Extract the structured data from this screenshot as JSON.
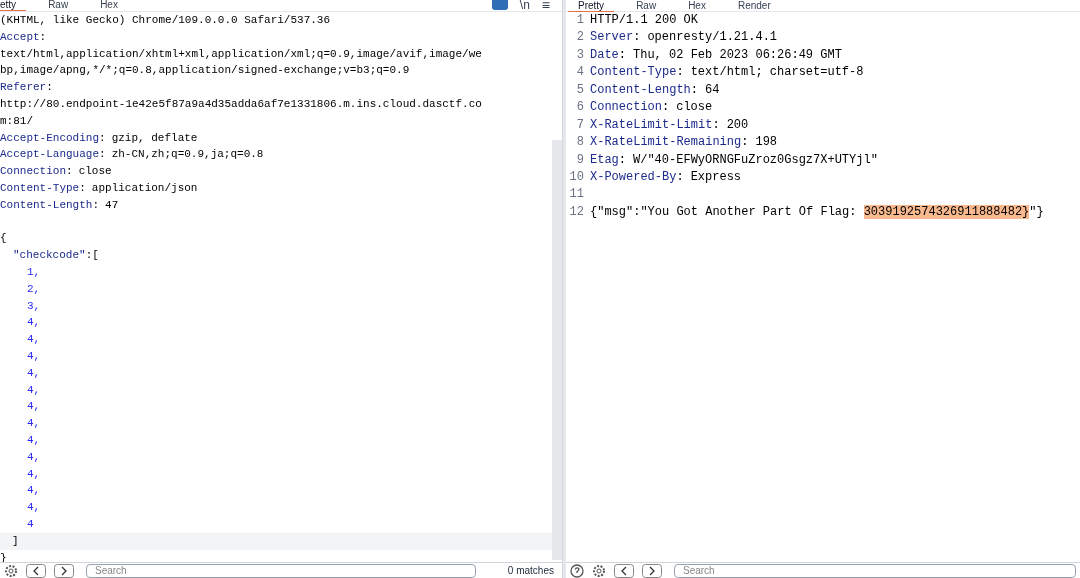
{
  "request_pane": {
    "tabs": [
      {
        "label": "etty",
        "selected": true
      },
      {
        "label": "Raw",
        "selected": false
      },
      {
        "label": "Hex",
        "selected": false
      }
    ],
    "toolbar": {
      "wrap_on": true,
      "newline_label": "\\n",
      "menu_label": "≡"
    },
    "lines": [
      {
        "kind": "text",
        "text": "(KHTML, like Gecko) Chrome/109.0.0.0 Safari/537.36",
        "current": false
      },
      {
        "kind": "header",
        "name": "Accept",
        "separator": ":",
        "current": false
      },
      {
        "kind": "text",
        "text": "text/html,application/xhtml+xml,application/xml;q=0.9,image/avif,image/we",
        "current": false
      },
      {
        "kind": "text",
        "text": "bp,image/apng,*/*;q=0.8,application/signed-exchange;v=b3;q=0.9",
        "current": false
      },
      {
        "kind": "header",
        "name": "Referer",
        "separator": ":",
        "current": false
      },
      {
        "kind": "text",
        "text": "http://80.endpoint-1e42e5f87a9a4d35adda6af7e1331806.m.ins.cloud.dasctf.co",
        "current": false
      },
      {
        "kind": "text",
        "text": "m:81/",
        "current": false
      },
      {
        "kind": "header",
        "name": "Accept-Encoding",
        "separator": ":",
        "value": "gzip, deflate",
        "current": false
      },
      {
        "kind": "header",
        "name": "Accept-Language",
        "separator": ":",
        "value": "zh-CN,zh;q=0.9,ja;q=0.8",
        "current": false
      },
      {
        "kind": "header",
        "name": "Connection",
        "separator": ":",
        "value": "close",
        "current": false
      },
      {
        "kind": "header",
        "name": "Content-Type",
        "separator": ":",
        "value": "application/json",
        "current": false
      },
      {
        "kind": "header",
        "name": "Content-Length",
        "separator": ":",
        "value": "47",
        "current": false
      },
      {
        "kind": "blank",
        "current": false
      },
      {
        "kind": "brace",
        "text": "{",
        "current": false
      },
      {
        "kind": "key",
        "key": "\"checkcode\"",
        "rest": ":[",
        "current": false
      },
      {
        "kind": "number",
        "text": "1,",
        "current": false
      },
      {
        "kind": "number",
        "text": "2,",
        "current": false
      },
      {
        "kind": "number",
        "text": "3,",
        "current": false
      },
      {
        "kind": "number",
        "text": "4,",
        "current": false
      },
      {
        "kind": "number",
        "text": "4,",
        "current": false
      },
      {
        "kind": "number",
        "text": "4,",
        "current": false
      },
      {
        "kind": "number",
        "text": "4,",
        "current": false
      },
      {
        "kind": "number",
        "text": "4,",
        "current": false
      },
      {
        "kind": "number",
        "text": "4,",
        "current": false
      },
      {
        "kind": "number",
        "text": "4,",
        "current": false
      },
      {
        "kind": "number",
        "text": "4,",
        "current": false
      },
      {
        "kind": "number",
        "text": "4,",
        "current": false
      },
      {
        "kind": "number",
        "text": "4,",
        "current": false
      },
      {
        "kind": "number",
        "text": "4,",
        "current": false
      },
      {
        "kind": "number",
        "text": "4,",
        "current": false
      },
      {
        "kind": "number",
        "text": "4",
        "current": false
      },
      {
        "kind": "bracket",
        "text": "]",
        "current": true
      },
      {
        "kind": "brace",
        "text": "}",
        "current": false
      }
    ],
    "search": {
      "placeholder": "Search",
      "matches": "0 matches"
    }
  },
  "response_pane": {
    "tabs": [
      {
        "label": "Pretty",
        "selected": true
      },
      {
        "label": "Raw",
        "selected": false
      },
      {
        "label": "Hex",
        "selected": false
      },
      {
        "label": "Render",
        "selected": false
      }
    ],
    "lines": [
      {
        "number": "1",
        "kind": "status",
        "text": "HTTP/1.1 200 OK"
      },
      {
        "number": "2",
        "kind": "header",
        "name": "Server",
        "separator": ":",
        "value": "openresty/1.21.4.1"
      },
      {
        "number": "3",
        "kind": "header",
        "name": "Date",
        "separator": ":",
        "value": "Thu, 02 Feb 2023 06:26:49 GMT"
      },
      {
        "number": "4",
        "kind": "header",
        "name": "Content-Type",
        "separator": ":",
        "value": "text/html; charset=utf-8"
      },
      {
        "number": "5",
        "kind": "header",
        "name": "Content-Length",
        "separator": ":",
        "value": "64"
      },
      {
        "number": "6",
        "kind": "header",
        "name": "Connection",
        "separator": ":",
        "value": "close"
      },
      {
        "number": "7",
        "kind": "header",
        "name": "X-RateLimit-Limit",
        "separator": ":",
        "value": "200"
      },
      {
        "number": "8",
        "kind": "header",
        "name": "X-RateLimit-Remaining",
        "separator": ":",
        "value": "198"
      },
      {
        "number": "9",
        "kind": "header",
        "name": "Etag",
        "separator": ":",
        "value": "W/\"40-EFWyORNGFuZroz0Gsgz7X+UTYjl\""
      },
      {
        "number": "10",
        "kind": "header",
        "name": "X-Powered-By",
        "separator": ":",
        "value": "Express"
      },
      {
        "number": "11",
        "kind": "blank"
      },
      {
        "number": "12",
        "kind": "body",
        "segments": [
          {
            "text": "{\"msg\":\"You Got Another Part Of Flag: ",
            "highlighted": false
          },
          {
            "text": "3039192574326911888482}",
            "highlighted": true
          },
          {
            "text": "\"}",
            "highlighted": false
          }
        ]
      }
    ],
    "search": {
      "placeholder": "Search"
    }
  }
}
